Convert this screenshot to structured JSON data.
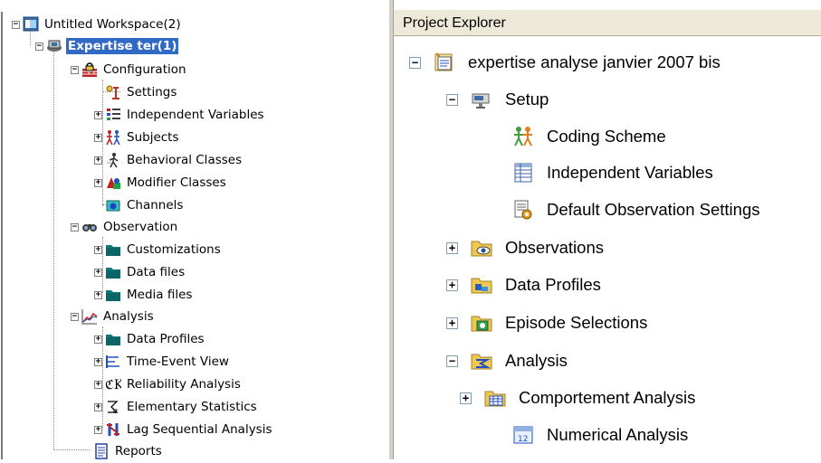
{
  "left_tree": {
    "root": {
      "label": "Untitled Workspace(2)",
      "icon": "workspace-icon",
      "expanded": true
    },
    "project": {
      "label": "Expertise ter(1)",
      "icon": "project-icon",
      "expanded": true,
      "selected": true
    },
    "configuration": {
      "label": "Configuration",
      "icon": "configuration-icon",
      "expanded": true,
      "items": [
        {
          "label": "Settings",
          "icon": "settings-icon",
          "expander": false
        },
        {
          "label": "Independent Variables",
          "icon": "independent-variables-icon",
          "expander": true
        },
        {
          "label": "Subjects",
          "icon": "subjects-icon",
          "expander": true
        },
        {
          "label": "Behavioral Classes",
          "icon": "behavioral-classes-icon",
          "expander": true
        },
        {
          "label": "Modifier Classes",
          "icon": "modifier-classes-icon",
          "expander": true
        },
        {
          "label": "Channels",
          "icon": "channels-icon",
          "expander": false
        }
      ]
    },
    "observation": {
      "label": "Observation",
      "icon": "observation-icon",
      "expanded": true,
      "items": [
        {
          "label": "Customizations",
          "icon": "folder-icon",
          "expander": true
        },
        {
          "label": "Data files",
          "icon": "folder-icon",
          "expander": true
        },
        {
          "label": "Media files",
          "icon": "folder-icon",
          "expander": true
        }
      ]
    },
    "analysis": {
      "label": "Analysis",
      "icon": "analysis-icon",
      "expanded": true,
      "items": [
        {
          "label": "Data Profiles",
          "icon": "folder-icon",
          "expander": true
        },
        {
          "label": "Time-Event View",
          "icon": "time-event-icon",
          "expander": true
        },
        {
          "label": "Reliability Analysis",
          "icon": "reliability-icon",
          "expander": true
        },
        {
          "label": "Elementary Statistics",
          "icon": "statistics-icon",
          "expander": true
        },
        {
          "label": "Lag Sequential Analysis",
          "icon": "lag-sequential-icon",
          "expander": true
        }
      ]
    },
    "reports": {
      "label": "Reports",
      "icon": "reports-icon"
    }
  },
  "right_panel": {
    "title": "Project Explorer",
    "root": {
      "label": "expertise analyse janvier 2007 bis",
      "icon": "project-icon",
      "expanded": true
    },
    "setup": {
      "label": "Setup",
      "icon": "setup-icon",
      "expanded": true,
      "items": [
        {
          "label": "Coding Scheme",
          "icon": "coding-scheme-icon"
        },
        {
          "label": "Independent Variables",
          "icon": "independent-variables-icon"
        },
        {
          "label": "Default Observation Settings",
          "icon": "observation-settings-icon"
        }
      ]
    },
    "observations": {
      "label": "Observations",
      "icon": "observations-icon",
      "expanded": false
    },
    "data_profiles": {
      "label": "Data Profiles",
      "icon": "data-profiles-icon",
      "expanded": false
    },
    "episode_selections": {
      "label": "Episode Selections",
      "icon": "episode-selections-icon",
      "expanded": false
    },
    "analysis": {
      "label": "Analysis",
      "icon": "analysis-icon",
      "expanded": true,
      "items": [
        {
          "label": "Comportement Analysis",
          "icon": "comportement-analysis-icon",
          "expander": true
        },
        {
          "label": "Numerical Analysis",
          "icon": "numerical-analysis-icon",
          "expander": false
        }
      ]
    }
  },
  "colors": {
    "selection": "#316ac5",
    "folder": "#0b7a7a",
    "header_bg": "#ece9d8"
  }
}
